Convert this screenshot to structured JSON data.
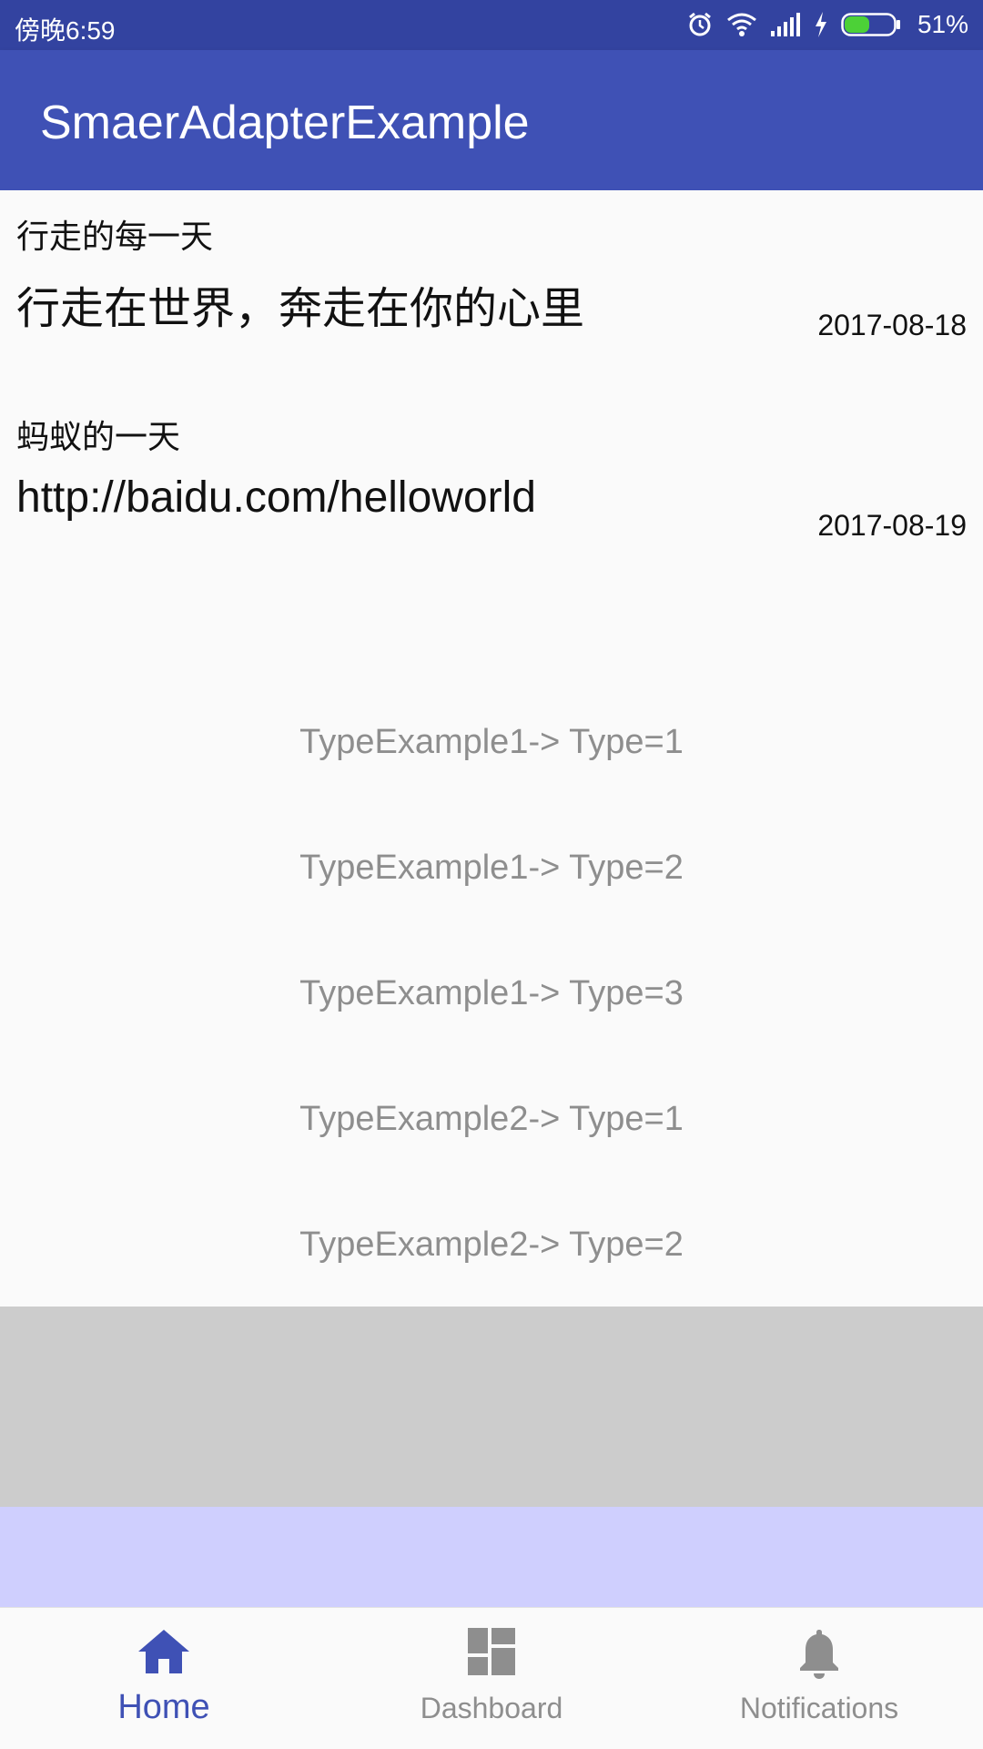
{
  "status_bar": {
    "time": "傍晚6:59",
    "battery_percent": "51%",
    "battery_level": 0.51,
    "icons": [
      "alarm-icon",
      "wifi-icon",
      "signal-icon",
      "charging-icon",
      "battery-icon"
    ]
  },
  "app_bar": {
    "title": "SmaerAdapterExample",
    "color": "#3f51b5"
  },
  "articles": [
    {
      "title": "行走的每一天",
      "body": "行走在世界，奔走在你的心里",
      "date": "2017-08-18"
    },
    {
      "title": "蚂蚁的一天",
      "body": "http://baidu.com/helloworld",
      "date": "2017-08-19"
    }
  ],
  "type_items": [
    "TypeExample1-> Type=1",
    "TypeExample1-> Type=2",
    "TypeExample1-> Type=3",
    "TypeExample2-> Type=1",
    "TypeExample2-> Type=2"
  ],
  "bottom_nav": {
    "items": [
      {
        "label": "Home",
        "icon": "home-icon",
        "active": true
      },
      {
        "label": "Dashboard",
        "icon": "dashboard-icon",
        "active": false
      },
      {
        "label": "Notifications",
        "icon": "bell-icon",
        "active": false
      }
    ],
    "active_color": "#3f51b5",
    "inactive_color": "#8e8e8e"
  }
}
